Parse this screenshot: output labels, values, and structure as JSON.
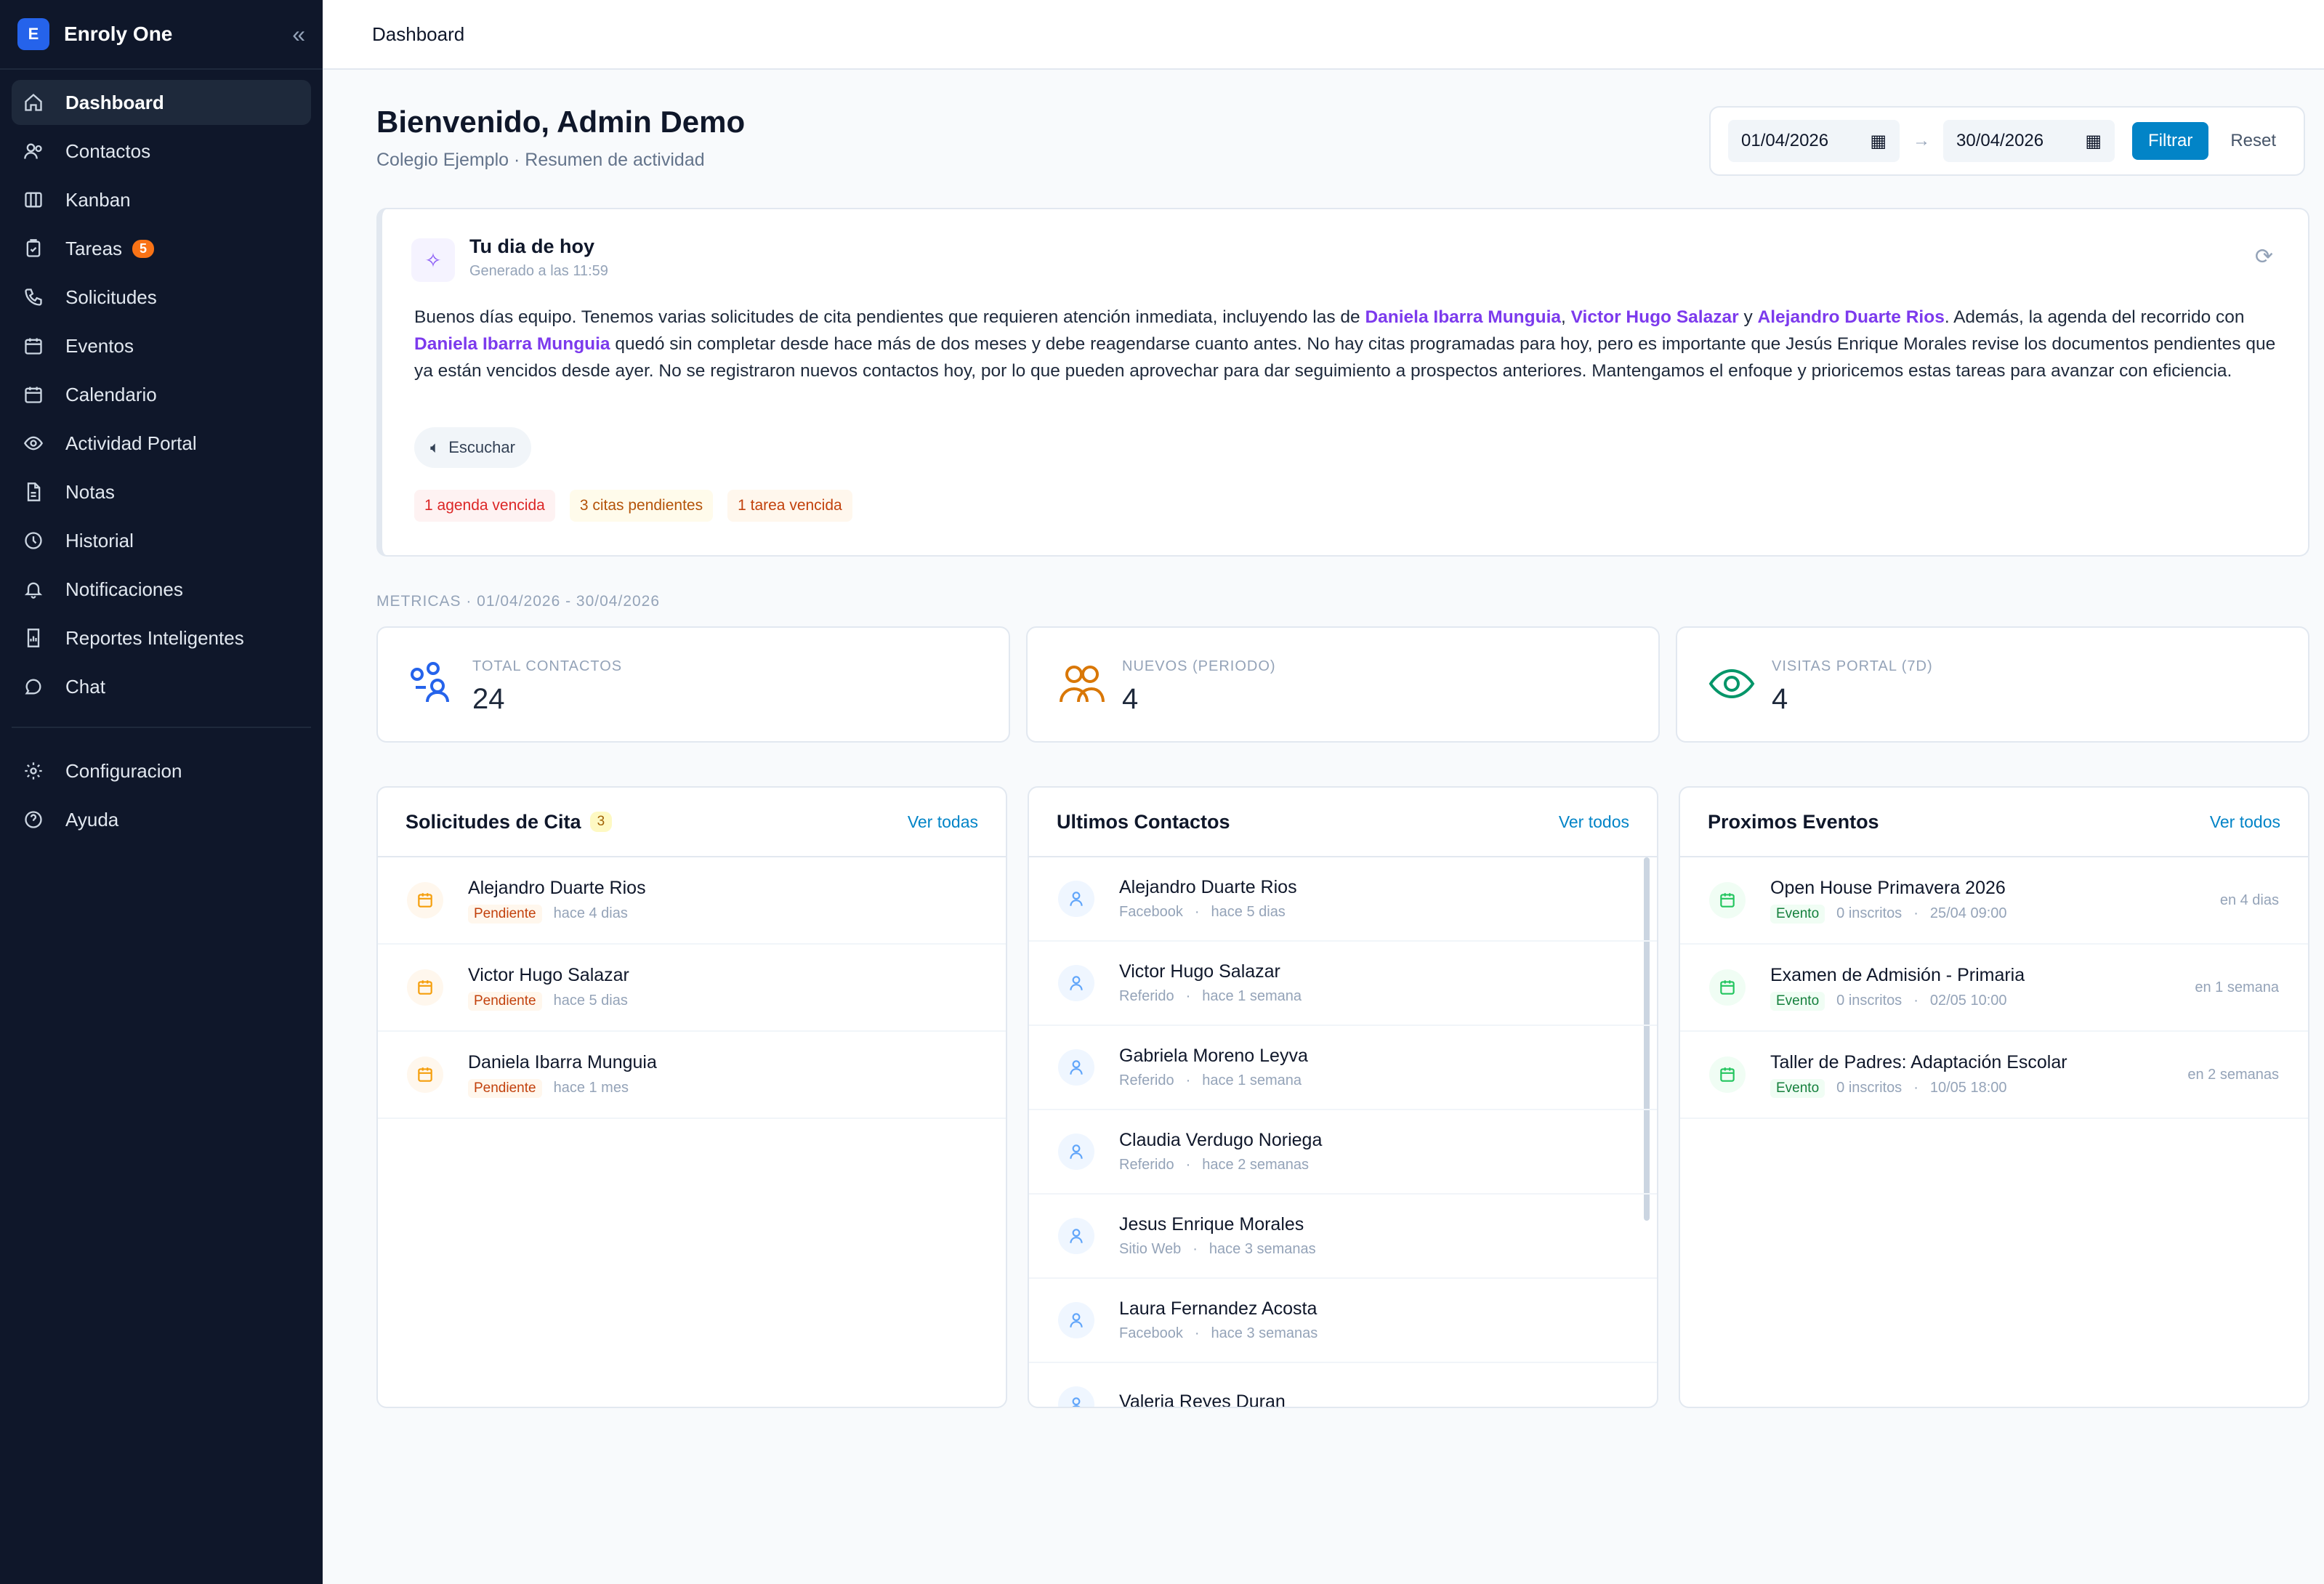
{
  "app": {
    "name": "Enroly One",
    "logo_letter": "E",
    "collapse_glyph": "«"
  },
  "sidebar": {
    "items": [
      {
        "label": "Dashboard",
        "icon": "home-icon"
      },
      {
        "label": "Contactos",
        "icon": "contacts-icon"
      },
      {
        "label": "Kanban",
        "icon": "kanban-icon"
      },
      {
        "label": "Tareas",
        "icon": "clipboard-icon",
        "badge": "5"
      },
      {
        "label": "Solicitudes",
        "icon": "phone-icon"
      },
      {
        "label": "Eventos",
        "icon": "calendar-icon"
      },
      {
        "label": "Calendario",
        "icon": "calendar-icon"
      },
      {
        "label": "Actividad Portal",
        "icon": "eye-icon"
      },
      {
        "label": "Notas",
        "icon": "file-icon"
      },
      {
        "label": "Historial",
        "icon": "clock-icon"
      },
      {
        "label": "Notificaciones",
        "icon": "bell-icon"
      },
      {
        "label": "Reportes Inteligentes",
        "icon": "report-icon"
      },
      {
        "label": "Chat",
        "icon": "chat-icon"
      }
    ],
    "footer_items": [
      {
        "label": "Configuracion",
        "icon": "gear-icon"
      },
      {
        "label": "Ayuda",
        "icon": "help-icon"
      }
    ]
  },
  "topbar": {
    "breadcrumb": "Dashboard"
  },
  "welcome": {
    "title": "Bienvenido, Admin Demo",
    "subtitle": "Colegio Ejemplo · Resumen de actividad"
  },
  "filter": {
    "from": "01/04/2026",
    "arrow": "→",
    "to": "30/04/2026",
    "apply": "Filtrar",
    "reset": "Reset"
  },
  "today": {
    "icon_glyph": "✧",
    "refresh_glyph": "⟳",
    "title": "Tu dia de hoy",
    "generated": "Generado a las 11:59",
    "text_1": "Buenos días equipo. Tenemos varias solicitudes de cita pendientes que requieren atención inmediata, incluyendo las de ",
    "name_1": "Daniela Ibarra Munguia",
    "sep_1": ", ",
    "name_2": "Victor Hugo Salazar",
    "sep_2": " y ",
    "name_3": "Alejandro Duarte Rios",
    "text_2": ". Además, la agenda del recorrido con ",
    "name_4": "Daniela Ibarra Munguia",
    "text_3": " quedó sin completar desde hace más de dos meses y debe reagendarse cuanto antes. No hay citas programadas para hoy, pero es importante que Jesús Enrique Morales revise los documentos pendientes que ya están vencidos desde ayer. No se registraron nuevos contactos hoy, por lo que pueden aprovechar para dar seguimiento a prospectos anteriores. Mantengamos el enfoque y prioricemos estas tareas para avanzar con eficiencia.",
    "listen": "Escuchar",
    "tags": [
      "1 agenda vencida",
      "3 citas pendientes",
      "1 tarea vencida"
    ]
  },
  "metrics": {
    "label": "METRICAS · 01/04/2026 - 30/04/2026",
    "cards": [
      {
        "label": "TOTAL CONTACTOS",
        "value": "24",
        "color": "#2563eb"
      },
      {
        "label": "NUEVOS (PERIODO)",
        "value": "4",
        "color": "#d97706"
      },
      {
        "label": "VISITAS PORTAL (7D)",
        "value": "4",
        "color": "#059669"
      }
    ]
  },
  "solicitudes": {
    "title": "Solicitudes de Cita",
    "count": "3",
    "link": "Ver todas",
    "items": [
      {
        "name": "Alejandro Duarte Rios",
        "status": "Pendiente",
        "time": "hace 4 dias"
      },
      {
        "name": "Victor Hugo Salazar",
        "status": "Pendiente",
        "time": "hace 5 dias"
      },
      {
        "name": "Daniela Ibarra Munguia",
        "status": "Pendiente",
        "time": "hace 1 mes"
      }
    ]
  },
  "contactos": {
    "title": "Ultimos Contactos",
    "link": "Ver todos",
    "items": [
      {
        "name": "Alejandro Duarte Rios",
        "source": "Facebook",
        "time": "hace 5 dias"
      },
      {
        "name": "Victor Hugo Salazar",
        "source": "Referido",
        "time": "hace 1 semana"
      },
      {
        "name": "Gabriela Moreno Leyva",
        "source": "Referido",
        "time": "hace 1 semana"
      },
      {
        "name": "Claudia Verdugo Noriega",
        "source": "Referido",
        "time": "hace 2 semanas"
      },
      {
        "name": "Jesus Enrique Morales",
        "source": "Sitio Web",
        "time": "hace 3 semanas"
      },
      {
        "name": "Laura Fernandez Acosta",
        "source": "Facebook",
        "time": "hace 3 semanas"
      },
      {
        "name": "Valeria Reyes Duran",
        "source": "",
        "time": ""
      }
    ]
  },
  "eventos": {
    "title": "Proximos Eventos",
    "link": "Ver todos",
    "items": [
      {
        "name": "Open House Primavera 2026",
        "type": "Evento",
        "inscritos": "0 inscritos",
        "date": "25/04 09:00",
        "rel": "en 4 dias"
      },
      {
        "name": "Examen de Admisión - Primaria",
        "type": "Evento",
        "inscritos": "0 inscritos",
        "date": "02/05 10:00",
        "rel": "en 1 semana"
      },
      {
        "name": "Taller de Padres: Adaptación Escolar",
        "type": "Evento",
        "inscritos": "0 inscritos",
        "date": "10/05 18:00",
        "rel": "en 2 semanas"
      }
    ]
  }
}
